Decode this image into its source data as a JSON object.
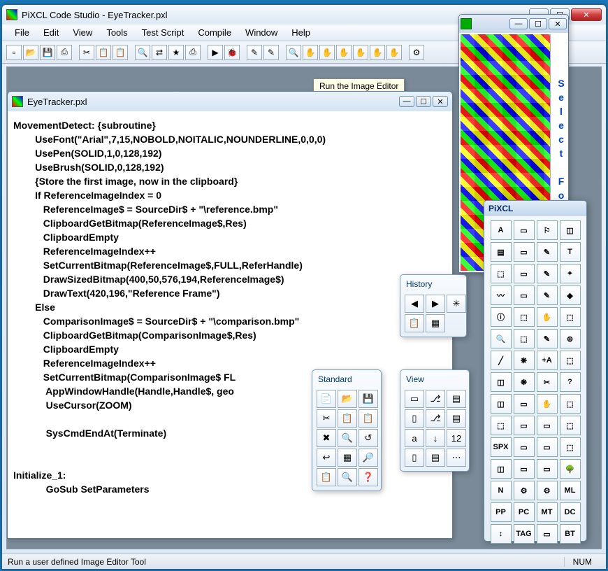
{
  "app": {
    "title": "PiXCL Code Studio - EyeTracker.pxl"
  },
  "menus": [
    "File",
    "Edit",
    "View",
    "Tools",
    "Test Script",
    "Compile",
    "Window",
    "Help"
  ],
  "toolbar_icons": [
    "new",
    "open",
    "save",
    "saveall",
    "",
    "cut",
    "copy",
    "paste",
    "",
    "find",
    "replace",
    "bookmark",
    "print",
    "",
    "run",
    "debug",
    "stop",
    "",
    "img-edit",
    "img-edit2",
    "",
    "zoom",
    "hand1",
    "hand2",
    "hand3",
    "hand4",
    "hand5",
    "hand6",
    "",
    "settings"
  ],
  "tooltip": "Run the Image Editor",
  "codewin": {
    "title": "EyeTracker.pxl"
  },
  "code": "MovementDetect: {subroutine}\n        UseFont(\"Arial\",7,15,NOBOLD,NOITALIC,NOUNDERLINE,0,0,0)\n        UsePen(SOLID,1,0,128,192)\n        UseBrush(SOLID,0,128,192)\n        {Store the first image, now in the clipboard}\n        If ReferenceImageIndex = 0\n           ReferenceImage$ = SourceDir$ + \"\\reference.bmp\"\n           ClipboardGetBitmap(ReferenceImage$,Res)\n           ClipboardEmpty\n           ReferenceImageIndex++\n           SetCurrentBitmap(ReferenceImage$,FULL,ReferHandle)\n           DrawSizedBitmap(400,50,576,194,ReferenceImage$)\n           DrawText(420,196,\"Reference Frame\")\n        Else\n           ComparisonImage$ = SourceDir$ + \"\\comparison.bmp\"\n           ClipboardGetBitmap(ComparisonImage$,Res)\n           ClipboardEmpty\n           ReferenceImageIndex++\n           SetCurrentBitmap(ComparisonImage$ FL\n            AppWindowHandle(Handle,Handle$, geo\n            UseCursor(ZOOM)\n\n            SysCmdEndAt(Terminate)\n\n\nInitialize_1:\n            GoSub SetParameters",
  "history": {
    "title": "History",
    "buttons": [
      "◀",
      "▶",
      "✳",
      "📋",
      "▦"
    ]
  },
  "standard": {
    "title": "Standard",
    "buttons": [
      "📄",
      "📂",
      "💾",
      "✂",
      "📋",
      "📋",
      "✖",
      "🔍",
      "↺",
      "↩",
      "▦",
      "🔎",
      "📋",
      "🔍",
      "❓"
    ]
  },
  "view": {
    "title": "View",
    "buttons": [
      "▭",
      "⎇",
      "▤",
      "▯",
      "⎇",
      "▤",
      "a",
      "↓",
      "12",
      "▯",
      "▤",
      "⋯"
    ]
  },
  "pixclwin": {
    "selectfont": "Select Font"
  },
  "bigpalette": {
    "title": "PiXCL",
    "buttons": [
      "A",
      "▭",
      "⚐",
      "◫",
      "▤",
      "▭",
      "✎",
      "T",
      "⬚",
      "▭",
      "✎",
      "⌖",
      "〰",
      "▭",
      "✎",
      "◆",
      "ⓘ",
      "⬚",
      "✋",
      "⬚",
      "🔍",
      "⬚",
      "✎",
      "⊕",
      "╱",
      "❋",
      "+A",
      "⬚",
      "◫",
      "❋",
      "✂",
      "?",
      "◫",
      "▭",
      "✋",
      "⬚",
      "⬚",
      "▭",
      "▭",
      "⬚",
      "SPX",
      "▭",
      "▭",
      "⬚",
      "◫",
      "▭",
      "▭",
      "🌳",
      "N",
      "⚙",
      "⚙",
      "ML",
      "PP",
      "PC",
      "MT",
      "DC",
      "↕",
      "TAG",
      "▭",
      "BT"
    ]
  },
  "status": {
    "text": "Run a user defined Image Editor Tool",
    "num": "NUM"
  }
}
